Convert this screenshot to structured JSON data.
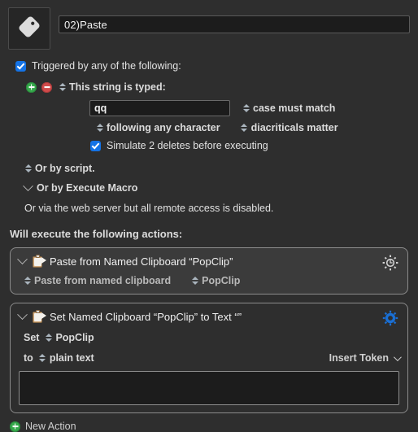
{
  "window": {
    "macro_icon": "tag-icon",
    "title_value": "02)Paste"
  },
  "trigger": {
    "enabled_label": "Triggered by any of the following:",
    "add_icon": "plus-circle-icon",
    "remove_icon": "minus-circle-icon",
    "type_label": "This string is typed:",
    "string_value": "qq",
    "case_option": "case must match",
    "following_option": "following any character",
    "diacritics_option": "diacriticals matter",
    "simulate_deletes_label": "Simulate 2 deletes before executing",
    "or_by_script": "Or by script.",
    "or_by_execute_macro": "Or by Execute Macro",
    "web_server_note": "Or via the web server but all remote access is disabled."
  },
  "actions_section": {
    "heading": "Will execute the following actions:",
    "new_action_label": "New Action",
    "new_action_icon": "plus-circle-icon",
    "items": [
      {
        "icon": "clipboard-paste-icon",
        "disclosure_icon": "chevron-down-icon",
        "title": "Paste from Named Clipboard “PopClip”",
        "gear_icon": "gear-icon",
        "gear_state": "inactive",
        "option_action": "Paste from named clipboard",
        "option_clipboard": "PopClip"
      },
      {
        "icon": "clipboard-set-icon",
        "disclosure_icon": "chevron-down-icon",
        "title": "Set Named Clipboard “PopClip” to Text “”",
        "gear_icon": "gear-icon",
        "gear_state": "active",
        "set_label": "Set",
        "set_value": "PopClip",
        "to_label": "to",
        "to_value": "plain text",
        "insert_token_label": "Insert Token",
        "insert_token_icon": "chevron-down-icon",
        "text_value": ""
      }
    ]
  },
  "colors": {
    "background": "#2e2e2e",
    "accent_blue": "#1473e6",
    "gear_active": "#1a6fd4",
    "add_green": "#36a94b",
    "remove_red": "#d14b4b",
    "field_background": "#1c1c1c",
    "action_filled": "#3b3b3b"
  }
}
